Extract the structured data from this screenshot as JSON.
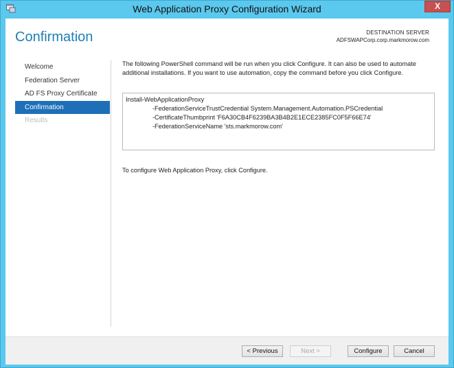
{
  "window": {
    "title": "Web Application Proxy Configuration Wizard",
    "close_label": "X",
    "accent_color": "#5bc8ee"
  },
  "page": {
    "title": "Confirmation",
    "destination_label": "DESTINATION SERVER",
    "destination_value": "ADFSWAPCorp.corp.markmorow.com"
  },
  "nav": {
    "items": [
      {
        "label": "Welcome",
        "state": "normal"
      },
      {
        "label": "Federation Server",
        "state": "normal"
      },
      {
        "label": "AD FS Proxy Certificate",
        "state": "normal"
      },
      {
        "label": "Confirmation",
        "state": "active"
      },
      {
        "label": "Results",
        "state": "disabled"
      }
    ],
    "active_color": "#1e6fb8"
  },
  "content": {
    "description": "The following PowerShell command will be run when you click Configure. It can also be used to automate additional installations. If you want to use automation, copy the command before you click Configure.",
    "command_lines": [
      "Install-WebApplicationProxy",
      "-FederationServiceTrustCredential System.Management.Automation.PSCredential",
      "-CertificateThumbprint 'F6A30CB4F6239BA3B4B2E1ECE2385FC0F5F66E74'",
      "-FederationServiceName 'sts.markmorow.com'"
    ],
    "hint": "To configure Web Application Proxy, click Configure."
  },
  "footer": {
    "previous_label": "< Previous",
    "next_label": "Next >",
    "configure_label": "Configure",
    "cancel_label": "Cancel"
  }
}
